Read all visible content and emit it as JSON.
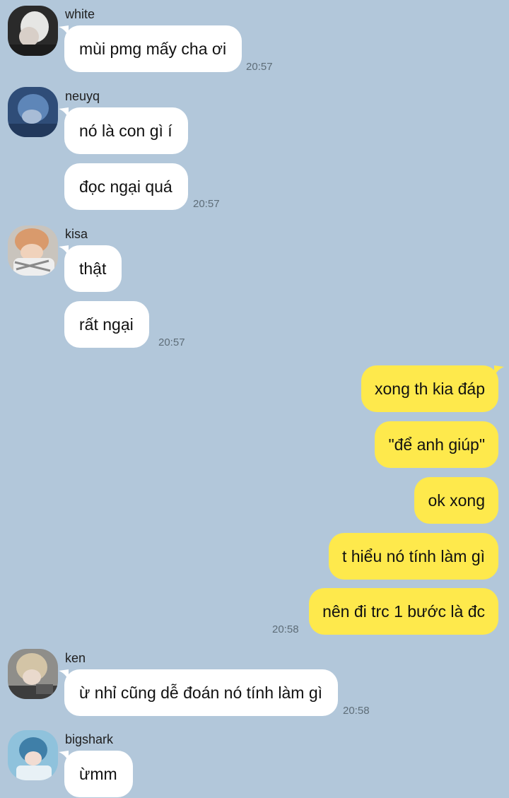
{
  "colors": {
    "background": "#b2c7da",
    "incoming_bubble": "#ffffff",
    "outgoing_bubble": "#fee94c",
    "timestamp": "#5e6d78"
  },
  "messages": {
    "white": {
      "sender": "white",
      "avatar_icon": "profile-photo-icon",
      "texts": [
        "mùi pmg mấy cha ơi"
      ],
      "time": "20:57"
    },
    "neuyq": {
      "sender": "neuyq",
      "avatar_icon": "profile-photo-icon",
      "texts": [
        "nó là con gì í",
        "đọc ngại quá"
      ],
      "time": "20:57"
    },
    "kisa": {
      "sender": "kisa",
      "avatar_icon": "profile-photo-icon",
      "texts": [
        "thật",
        "rất ngại"
      ],
      "time": "20:57"
    },
    "me": {
      "texts": [
        "xong th kia đáp",
        "\"để anh giúp\"",
        "ok xong",
        "t hiểu nó tính làm gì",
        "nên đi trc 1 bước là đc"
      ],
      "time": "20:58"
    },
    "ken": {
      "sender": "ken",
      "avatar_icon": "profile-photo-icon",
      "texts": [
        "ừ nhỉ cũng dễ đoán nó tính làm gì"
      ],
      "time": "20:58"
    },
    "bigshark": {
      "sender": "bigshark",
      "avatar_icon": "profile-photo-icon",
      "texts": [
        "ừmm"
      ]
    }
  }
}
